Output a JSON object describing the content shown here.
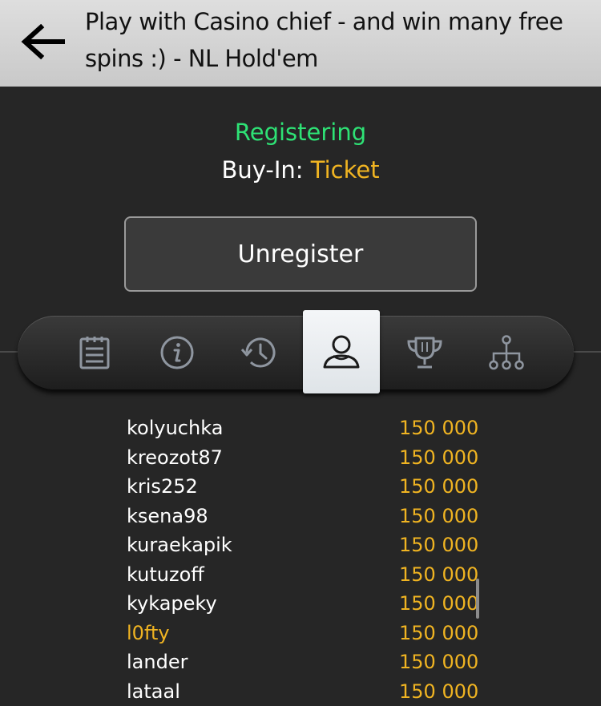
{
  "header": {
    "title": "Play with Casino chief - and win many free spins :) - NL Hold'em",
    "back_icon": "arrow-left-icon"
  },
  "status": {
    "label": "Registering",
    "color": "#2ee275"
  },
  "buyin": {
    "label": "Buy-In:",
    "value": "Ticket",
    "value_color": "#f0b422"
  },
  "unregister_label": "Unregister",
  "tabs": [
    {
      "icon": "clipboard-icon",
      "active": false
    },
    {
      "icon": "info-icon",
      "active": false
    },
    {
      "icon": "history-icon",
      "active": false
    },
    {
      "icon": "user-icon",
      "active": true
    },
    {
      "icon": "trophy-icon",
      "active": false
    },
    {
      "icon": "hierarchy-icon",
      "active": false
    }
  ],
  "players": [
    {
      "name": "kolyuchka",
      "chips": "150 000",
      "highlight": false
    },
    {
      "name": "kreozot87",
      "chips": "150 000",
      "highlight": false
    },
    {
      "name": "kris252",
      "chips": "150 000",
      "highlight": false
    },
    {
      "name": "ksena98",
      "chips": "150 000",
      "highlight": false
    },
    {
      "name": "kuraekapik",
      "chips": "150 000",
      "highlight": false
    },
    {
      "name": "kutuzoff",
      "chips": "150 000",
      "highlight": false
    },
    {
      "name": "kykapeky",
      "chips": "150 000",
      "highlight": false
    },
    {
      "name": "l0fty",
      "chips": "150 000",
      "highlight": true
    },
    {
      "name": "lander",
      "chips": "150 000",
      "highlight": false
    },
    {
      "name": "lataal",
      "chips": "150 000",
      "highlight": false
    }
  ]
}
